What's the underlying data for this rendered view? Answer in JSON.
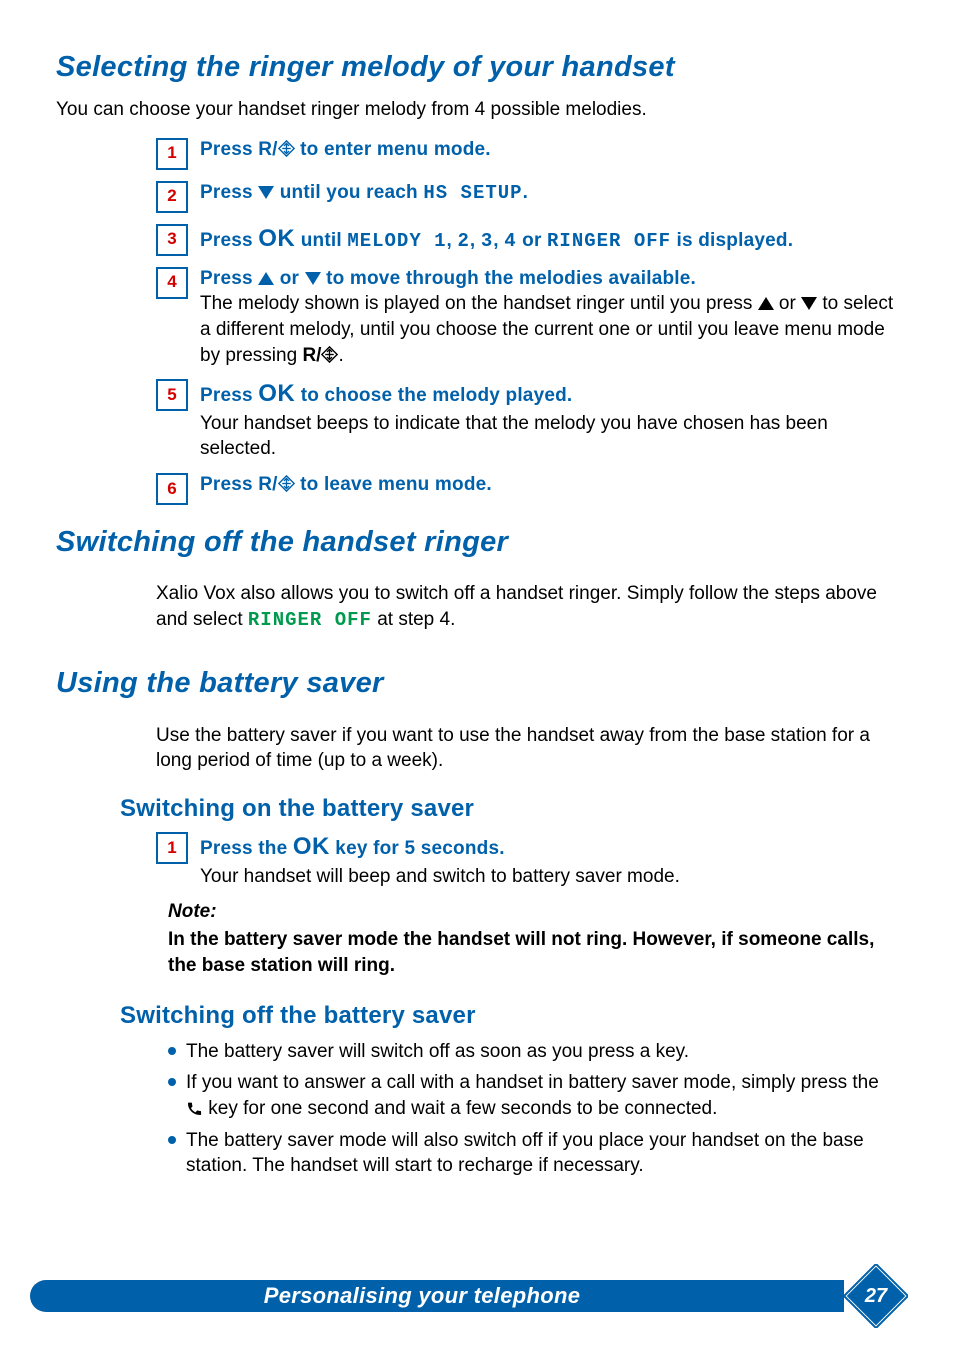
{
  "headings": {
    "h1a": "Selecting the ringer melody of your handset",
    "h1b": "Switching off the handset ringer",
    "h1c": "Using the battery saver",
    "h2a": "Switching on the battery saver",
    "h2b": "Switching off the battery saver"
  },
  "intro": {
    "melody": "You can choose your handset ringer melody from 4 possible melodies."
  },
  "steps": {
    "n1": "1",
    "n2": "2",
    "n3": "3",
    "n4": "4",
    "n5": "5",
    "n6": "6",
    "s1a": "Press ",
    "s1b": " to enter menu mode.",
    "s2a": "Press ",
    "s2b": " until you reach ",
    "s2c": "HS SETUP",
    "s2d": ".",
    "s3a": "Press ",
    "s3ok": "OK",
    "s3b": " until ",
    "s3c": "MELODY 1",
    "s3d": ", ",
    "s3e": "2",
    "s3f": ", ",
    "s3g": "3",
    "s3h": ", ",
    "s3i": "4",
    "s3j": " or ",
    "s3k": "RINGER OFF",
    "s3l": " is displayed.",
    "s4a": "Press ",
    "s4b": " or ",
    "s4c": " to move through the melodies available.",
    "s4desc_a": "The melody shown is played on the handset ringer until you press ",
    "s4desc_b": " or ",
    "s4desc_c": " to select a different melody, until you choose the current one or until you leave menu mode by pressing ",
    "s4desc_d": ".",
    "s5a": "Press ",
    "s5ok": "OK",
    "s5b": " to choose the melody played.",
    "s5desc": "Your handset beeps to indicate that the melody you have chosen has been selected.",
    "s6a": "Press ",
    "s6b": " to leave menu mode.",
    "r_key": "R/"
  },
  "ringer_off": {
    "p_a": "Xalio Vox also allows you to switch off a handset ringer.  Simply follow the steps above and select ",
    "p_code": "RINGER OFF",
    "p_b": " at step 4."
  },
  "battery": {
    "intro": "Use the battery saver if you want to use the handset away from the base station for a long period of time (up to a week).",
    "on_n1": "1",
    "on_s1a": "Press the ",
    "on_s1ok": "OK",
    "on_s1b": " key for 5 seconds.",
    "on_desc": "Your handset will beep and switch to battery saver mode.",
    "note_head": "Note:",
    "note_body": "In the battery saver mode the handset will not ring.  However, if someone calls, the base station will ring.",
    "off_li1": "The battery saver will switch off as soon as you press a key.",
    "off_li2a": "If you want to answer a call with a handset in battery saver mode, simply press the ",
    "off_li2b": " key for one second and wait a few seconds to be connected.",
    "off_li3": "The battery saver mode will also switch off if you place your handset on the base station.  The handset will start to recharge if necessary."
  },
  "footer": {
    "label": "Personalising your telephone",
    "page": "27"
  }
}
